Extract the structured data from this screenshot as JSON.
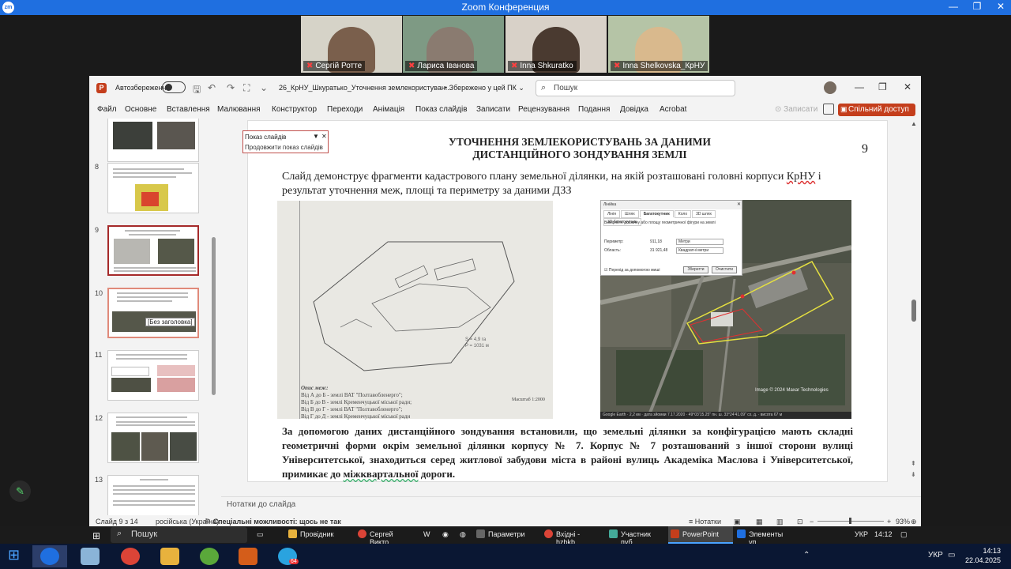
{
  "zoom": {
    "title": "Zoom Конференция",
    "logo": "zm",
    "participants": [
      {
        "name": "Сергій Ротте",
        "muted": true
      },
      {
        "name": "Лариса Іванова",
        "muted": true
      },
      {
        "name": "Inna Shkuratko",
        "muted": true
      },
      {
        "name": "Inna Shelkovska_КрНУ",
        "muted": true
      }
    ]
  },
  "ppt": {
    "autosave_label": "Автозбереження",
    "filename": "26_КрНУ_Шкуратько_Уточнення землекористуван...",
    "saved_status": "• Збережено у цей ПК ⌄",
    "search_placeholder": "Пошук",
    "tabs": [
      "Файл",
      "Основне",
      "Вставлення",
      "Малювання",
      "Конструктор",
      "Переходи",
      "Анімація",
      "Показ слайдів",
      "Записати",
      "Рецензування",
      "Подання",
      "Довідка",
      "Acrobat"
    ],
    "record_label": "Записати",
    "share_label": "Спільний доступ ⌄",
    "thumbnail_numbers": [
      "8",
      "9",
      "10",
      "11",
      "12",
      "13"
    ],
    "hover_tooltip": "[Без заголовка]",
    "slideshow_popup": {
      "title": "Показ слайдів",
      "continue": "Продовжити показ слайдів"
    },
    "notes_placeholder": "Нотатки до слайда",
    "status": {
      "slide": "Слайд 9 з 14",
      "language": "російська (Україна)",
      "accessibility": "Спеціальні можливості: щось не так",
      "notes": "Нотатки",
      "zoom": "93%"
    }
  },
  "slide": {
    "number": "9",
    "title": "УТОЧНЕННЯ ЗЕМЛЕКОРИСТУВАНЬ ЗА ДАНИМИ ДИСТАНЦІЙНОГО ЗОНДУВАННЯ ЗЕМЛІ",
    "intro_a": "Слайд демонструє фрагменти кадастрового плану земельної ділянки, на якій розташовані головні корпуси ",
    "intro_krnu": "КрНУ",
    "intro_b": " і результат уточнення меж, площі та периметру за даними ДЗЗ",
    "body_a": "За допомогою даних дистанційного зондування встановили, що земельні ділянки за конфігурацією мають складні геометричні форми окрім земельної ділянки корпусу № 7. Корпус № 7 розташований з іншої сторони вулиці Університетської, знаходиться серед житлової забудови міста в районі вулиць Академіка Маслова і Університетської, примикає до ",
    "body_u": "міжквартальної",
    "body_b": " дороги.",
    "scan": {
      "legend": [
        "Опис меж:",
        "Від А до Б - землі ВАТ \"Полтавобленерго\";",
        "Від Б до В - землі Кременчуцької міської ради;",
        "Від В до Г - землі ВАТ \"Полтавобленерго\";",
        "Від Г до Д - землі Кременчуцької міської ради"
      ],
      "scale": "Масштаб 1:2000",
      "area_a": "S = 4,9 га",
      "area_b": "P = 1031 м"
    },
    "sat": {
      "credit": "Image © 2024 Maxar Technologies",
      "footer": "Google Earth · 2,2 км · дата зйомки 7.17.2020 · 49°03'15.25\" пн. ш. 33°24'41.09\" сх. д. · висота 67 м",
      "dialog": {
        "title": "Лінійка",
        "tabs": [
          "Лінія",
          "Шлях",
          "Багатокутник",
          "Коло",
          "3D шлях",
          "3D багатокутник"
        ],
        "active_tab": "Багатокутник",
        "hint": "Виміряйте довжину або площу геометричної фігури на землі",
        "perimeter_label": "Периметр:",
        "perimeter_value": "911,18",
        "perimeter_unit": "Метри",
        "area_label": "Область:",
        "area_value": "31 921,48",
        "area_unit": "Квадратні метри",
        "checkbox": "Перехід за допомогою миші",
        "save": "Зберегти",
        "clear": "Очистити"
      }
    }
  },
  "dock": {
    "search": "Пошук",
    "items": [
      "Провідник",
      "Сергей Викто...",
      "Параметри",
      "Вхідні - hzbkb...",
      "Участник пуб...",
      "PowerPoint",
      "Элементы уп..."
    ],
    "lang": "УКР",
    "time": "14:12"
  },
  "taskbar": {
    "lang": "УКР",
    "time": "14:13",
    "date": "22.04.2025",
    "badge": "64"
  }
}
